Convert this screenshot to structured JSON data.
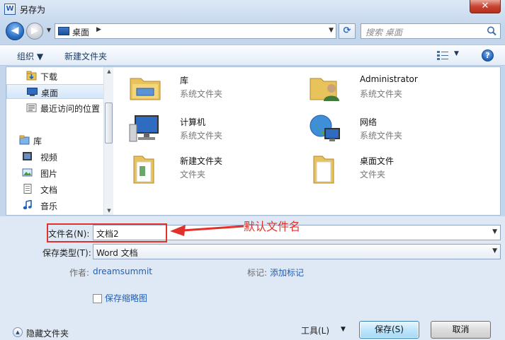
{
  "window": {
    "title": "另存为",
    "close_glyph": "✕",
    "app_icon_glyph": "W"
  },
  "address": {
    "crumb": "桌面",
    "crumb_arrow": "▶",
    "dropdown_glyph": "▼"
  },
  "nav_buttons": {
    "back_glyph": "◀",
    "forward_glyph": "▶",
    "recent_glyph": "▼",
    "refresh_glyph": "⟳"
  },
  "search": {
    "placeholder": "搜索 桌面"
  },
  "toolbar": {
    "organize": "组织 ▼",
    "new_folder": "新建文件夹",
    "view_dropdown_glyph": "▼",
    "help_glyph": "?"
  },
  "nav": {
    "items": [
      {
        "label": "下载",
        "icon": "download-folder-icon"
      },
      {
        "label": "桌面",
        "icon": "desktop-icon",
        "selected": true
      },
      {
        "label": "最近访问的位置",
        "icon": "recent-places-icon"
      },
      {
        "label": "库",
        "icon": "library-icon"
      },
      {
        "label": "视频",
        "icon": "video-icon"
      },
      {
        "label": "图片",
        "icon": "pictures-icon"
      },
      {
        "label": "文档",
        "icon": "documents-icon"
      },
      {
        "label": "音乐",
        "icon": "music-icon"
      }
    ],
    "scroll_up_glyph": "▲",
    "scroll_down_glyph": "▼"
  },
  "files": [
    {
      "name": "库",
      "type": "系统文件夹",
      "icon": "library-folder-icon"
    },
    {
      "name": "Administrator",
      "type": "系统文件夹",
      "icon": "user-folder-icon"
    },
    {
      "name": "计算机",
      "type": "系统文件夹",
      "icon": "computer-icon"
    },
    {
      "name": "网络",
      "type": "系统文件夹",
      "icon": "network-icon"
    },
    {
      "name": "新建文件夹",
      "type": "文件夹",
      "icon": "folder-icon"
    },
    {
      "name": "桌面文件",
      "type": "文件夹",
      "icon": "folder-icon"
    }
  ],
  "form": {
    "filename_label": "文件名(N):",
    "filename_value": "文档2",
    "filetype_label": "保存类型(T):",
    "filetype_value": "Word 文档",
    "dropdown_glyph": "▼",
    "author_label": "作者:",
    "author_value": "dreamsummit",
    "tags_label": "标记:",
    "tags_value": "添加标记",
    "thumbnail_label": "保存缩略图"
  },
  "footer": {
    "hide_folders": "隐藏文件夹",
    "hide_glyph": "▲",
    "tools": "工具(L)",
    "tools_dd": "▼",
    "save": "保存(S)",
    "cancel": "取消"
  },
  "annotation": {
    "text": "默认文件名",
    "color": "#e0322a"
  }
}
